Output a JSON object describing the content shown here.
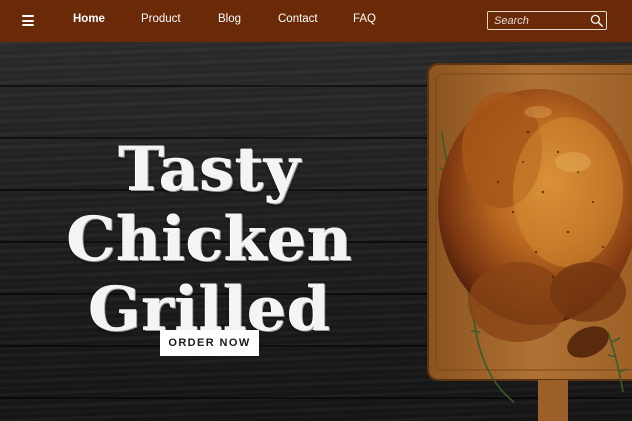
{
  "nav": {
    "items": [
      {
        "label": "Home",
        "active": true
      },
      {
        "label": "Product",
        "active": false
      },
      {
        "label": "Blog",
        "active": false
      },
      {
        "label": "Contact",
        "active": false
      },
      {
        "label": "FAQ",
        "active": false
      }
    ],
    "search": {
      "placeholder": "Search",
      "icon": "search-icon"
    },
    "menu_icon": "hamburger-menu-icon"
  },
  "hero": {
    "title_lines": [
      "Tasty",
      "Chicken",
      "Grilled"
    ],
    "cta_label": "ORDER NOW"
  },
  "colors": {
    "navbar": "#6a2a08",
    "background": "#1b1b1b",
    "title": "#f4f4f4",
    "button": "#ffffff"
  }
}
